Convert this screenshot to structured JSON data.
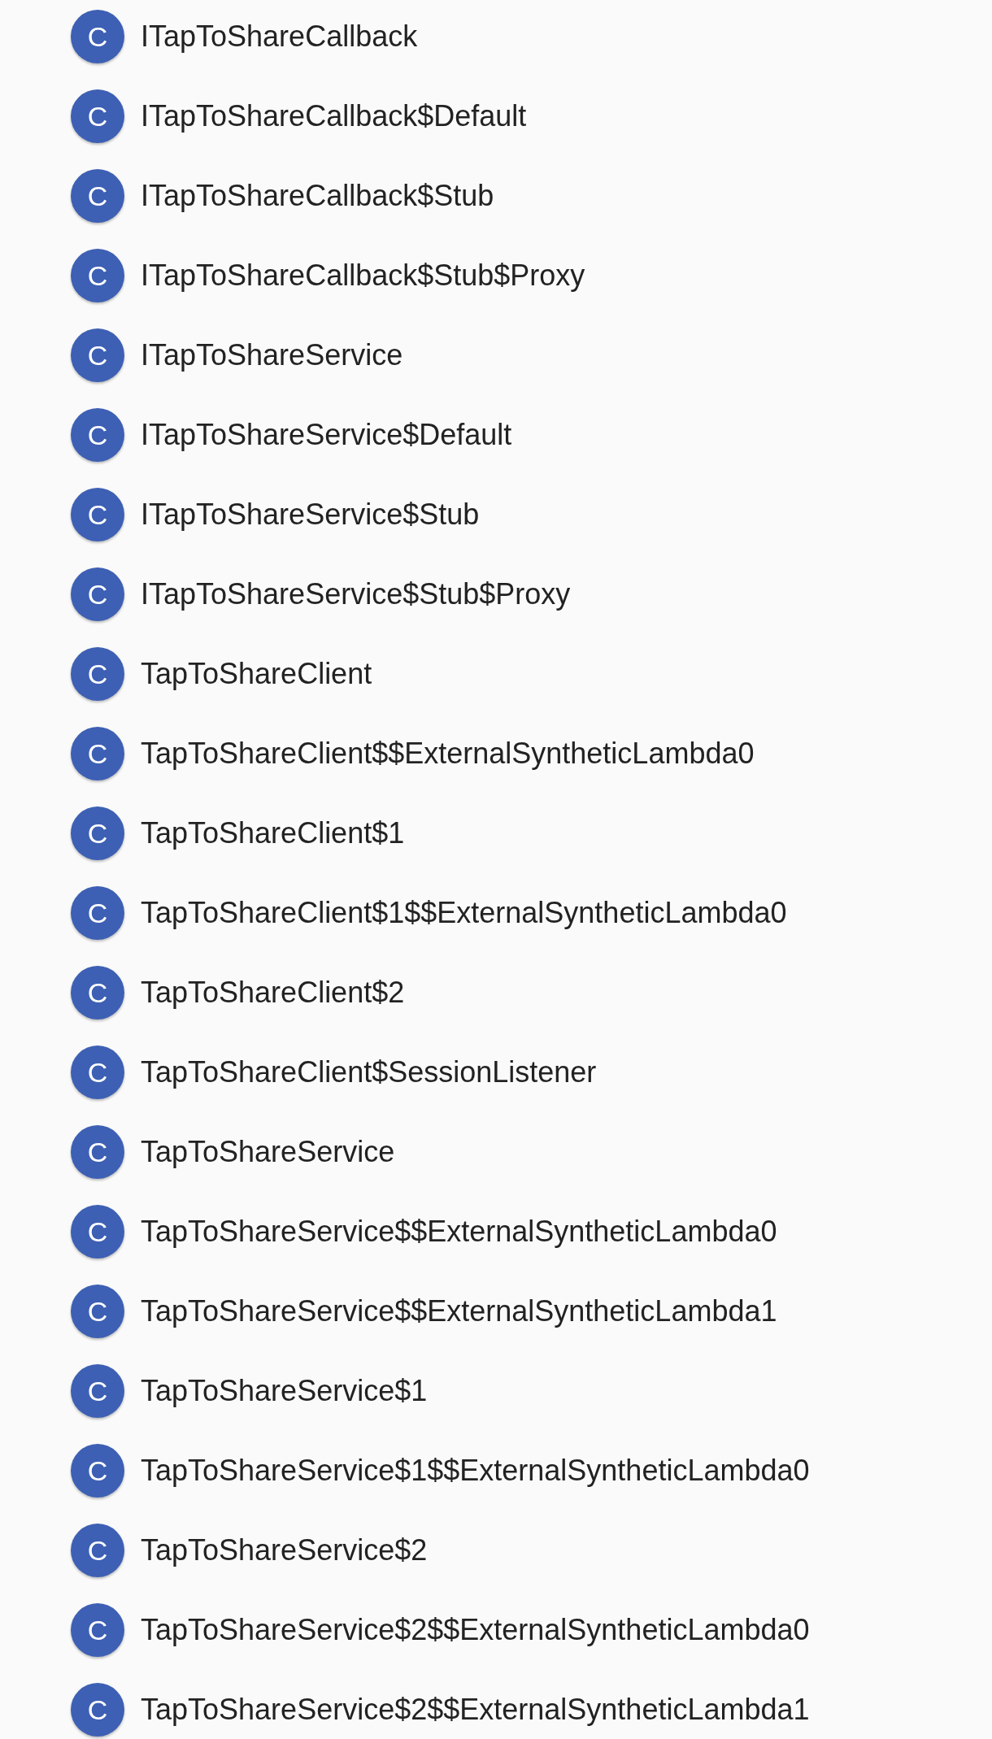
{
  "classes": [
    {
      "icon": "C",
      "name": "ITapToShareCallback"
    },
    {
      "icon": "C",
      "name": "ITapToShareCallback$Default"
    },
    {
      "icon": "C",
      "name": "ITapToShareCallback$Stub"
    },
    {
      "icon": "C",
      "name": "ITapToShareCallback$Stub$Proxy"
    },
    {
      "icon": "C",
      "name": "ITapToShareService"
    },
    {
      "icon": "C",
      "name": "ITapToShareService$Default"
    },
    {
      "icon": "C",
      "name": "ITapToShareService$Stub"
    },
    {
      "icon": "C",
      "name": "ITapToShareService$Stub$Proxy"
    },
    {
      "icon": "C",
      "name": "TapToShareClient"
    },
    {
      "icon": "C",
      "name": "TapToShareClient$$ExternalSyntheticLambda0"
    },
    {
      "icon": "C",
      "name": "TapToShareClient$1"
    },
    {
      "icon": "C",
      "name": "TapToShareClient$1$$ExternalSyntheticLambda0"
    },
    {
      "icon": "C",
      "name": "TapToShareClient$2"
    },
    {
      "icon": "C",
      "name": "TapToShareClient$SessionListener"
    },
    {
      "icon": "C",
      "name": "TapToShareService"
    },
    {
      "icon": "C",
      "name": "TapToShareService$$ExternalSyntheticLambda0"
    },
    {
      "icon": "C",
      "name": "TapToShareService$$ExternalSyntheticLambda1"
    },
    {
      "icon": "C",
      "name": "TapToShareService$1"
    },
    {
      "icon": "C",
      "name": "TapToShareService$1$$ExternalSyntheticLambda0"
    },
    {
      "icon": "C",
      "name": "TapToShareService$2"
    },
    {
      "icon": "C",
      "name": "TapToShareService$2$$ExternalSyntheticLambda0"
    },
    {
      "icon": "C",
      "name": "TapToShareService$2$$ExternalSyntheticLambda1"
    }
  ]
}
